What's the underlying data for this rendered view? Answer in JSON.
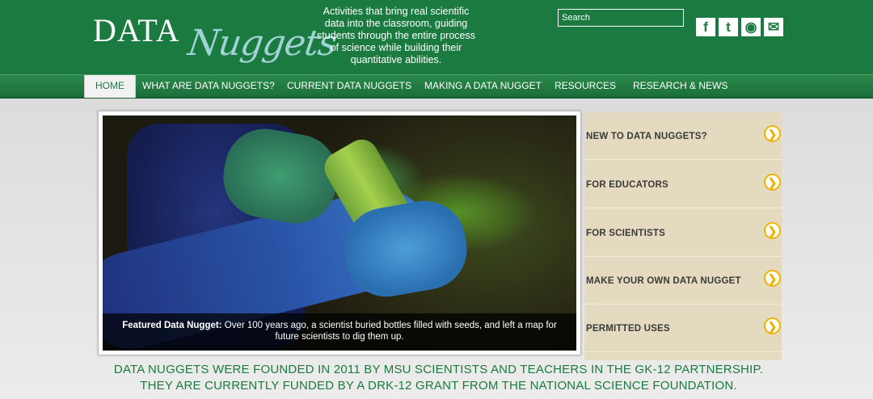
{
  "header": {
    "logo": {
      "data": "DATA",
      "nuggets": "Nuggets"
    },
    "tagline": "Activities that bring real scientific data into the classroom, guiding students through the entire process of science while building their quantitative abilities.",
    "search_placeholder": "Search",
    "social": [
      {
        "icon": "facebook-icon",
        "glyph": "f"
      },
      {
        "icon": "twitter-icon",
        "glyph": "t"
      },
      {
        "icon": "rss-icon",
        "glyph": "◉"
      },
      {
        "icon": "email-icon",
        "glyph": "✉"
      }
    ]
  },
  "nav": {
    "items": [
      {
        "label": "HOME"
      },
      {
        "label": "WHAT ARE DATA NUGGETS?"
      },
      {
        "label": "CURRENT DATA NUGGETS"
      },
      {
        "label": "MAKING A DATA NUGGET"
      },
      {
        "label": "RESOURCES"
      },
      {
        "label": "RESEARCH & NEWS"
      }
    ]
  },
  "feature": {
    "caption_label": "Featured Data Nugget:",
    "caption_text": "Over 100 years ago, a scientist buried bottles filled with seeds, and left a map for future scientists to dig them up."
  },
  "sidebar": {
    "items": [
      {
        "label": "NEW TO DATA NUGGETS?"
      },
      {
        "label": "FOR EDUCATORS"
      },
      {
        "label": "FOR SCIENTISTS"
      },
      {
        "label": "MAKE YOUR OWN DATA NUGGET"
      },
      {
        "label": "PERMITTED USES"
      }
    ],
    "arrow_glyph": "❯"
  },
  "founded": {
    "line1": "DATA NUGGETS WERE FOUNDED IN 2011 BY MSU SCIENTISTS AND TEACHERS IN THE GK-12 PARTNERSHIP.",
    "line2": "THEY ARE CURRENTLY FUNDED BY A DRK-12 GRANT FROM THE NATIONAL SCIENCE FOUNDATION."
  },
  "colors": {
    "brand_green": "#1b7a3f",
    "logo_teal": "#9fd3d6",
    "sidebar_beige": "#e4dac0",
    "arrow_gold": "#f0b400"
  }
}
